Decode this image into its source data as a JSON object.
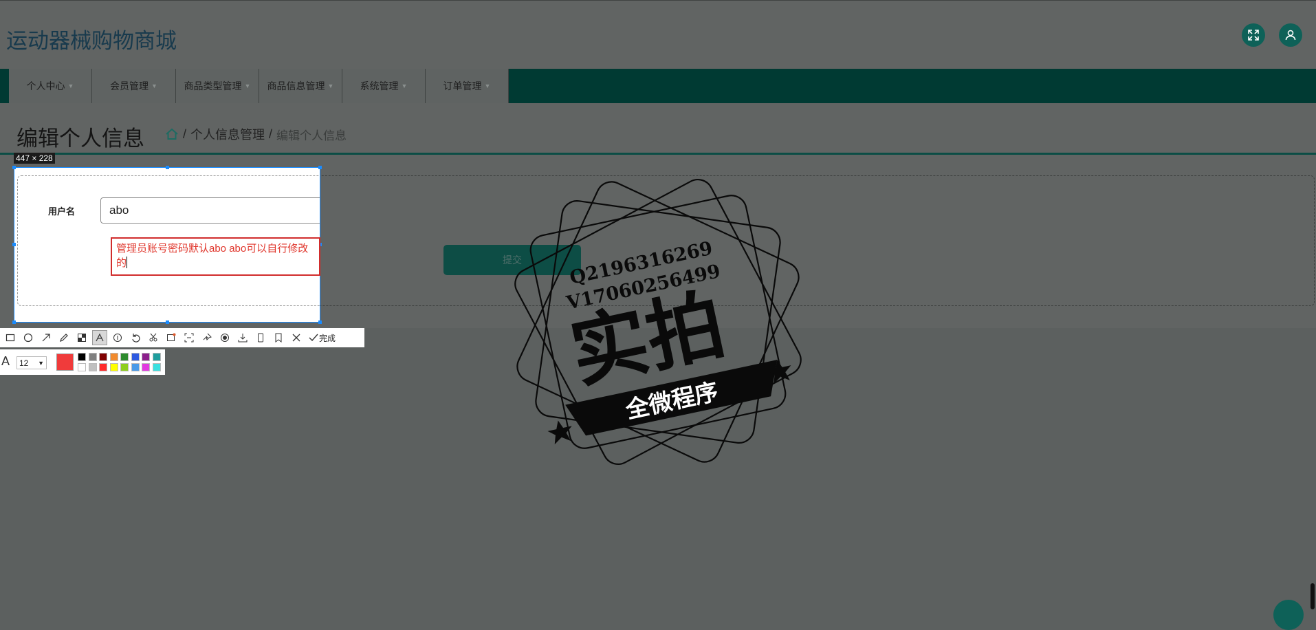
{
  "header": {
    "app_title": "运动器械购物商城",
    "fullscreen_icon": "expand-icon",
    "user_icon": "user-icon"
  },
  "nav": {
    "items": [
      {
        "label": "个人中心"
      },
      {
        "label": "会员管理"
      },
      {
        "label": "商品类型管理"
      },
      {
        "label": "商品信息管理"
      },
      {
        "label": "系统管理"
      },
      {
        "label": "订单管理"
      }
    ]
  },
  "page": {
    "title": "编辑个人信息",
    "breadcrumb": {
      "home_icon": "home-icon",
      "sep": "/",
      "level1": "个人信息管理",
      "current": "编辑个人信息"
    }
  },
  "form": {
    "username_label": "用户名",
    "username_value": "abo",
    "submit_label": "提交"
  },
  "screenshot_tool": {
    "size_label": "447 × 228",
    "annotation_text": "管理员账号密码默认abo abo可以自行修改的",
    "done_label": "完成",
    "font_size": "12",
    "current_color": "#f03b3b",
    "palette": [
      "#000000",
      "#808080",
      "#800000",
      "#f28b2e",
      "#2e8b2e",
      "#2e5ae0",
      "#8b1e8b",
      "#1e9e9e",
      "#ffffff",
      "#c0c0c0",
      "#ff2a2a",
      "#ffff00",
      "#8fce1e",
      "#4a9ae8",
      "#e23ae0",
      "#3ae0e0"
    ]
  },
  "watermark": {
    "line1": "Q2196316269",
    "line2": "V17060256499",
    "big_text": "实拍",
    "ribbon_text": "全微程序"
  },
  "colors": {
    "accent": "#0e6158",
    "nav_bg": "#003a33",
    "overlay_bg": "#5c605f"
  }
}
